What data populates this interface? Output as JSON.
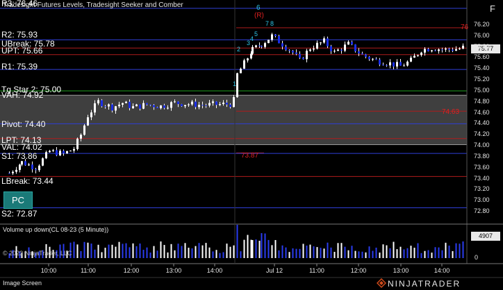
{
  "window": {
    "title": "Tradesight Futures Levels, Tradesight Seeker and Comber",
    "status_bar": "Image Screen",
    "brand": "NINJATRADER",
    "copyright": "© 2023 NinjaTrader, LLC",
    "f_button": "F",
    "pc_button": "PC"
  },
  "colors": {
    "background": "#000000",
    "up_candle": "#ffffff",
    "down_candle": "#1a2ee6",
    "level_blue": "#2f3fd8",
    "level_red": "#b01c1c",
    "value_area_fill": "#4a4a4a",
    "green_line": "#1fa21f",
    "teal_button": "#1a7a78"
  },
  "price_levels": [
    {
      "name": "R2",
      "label": "R2: 75.93",
      "price": 75.93,
      "color": "#2f3fd8"
    },
    {
      "name": "UBreak",
      "label": "UBreak: 75.78",
      "price": 75.78,
      "color": "#b01c1c"
    },
    {
      "name": "UPT",
      "label": "UPT: 75.66",
      "price": 75.66,
      "color": "#b01c1c"
    },
    {
      "name": "R1",
      "label": "R1: 75.39",
      "price": 75.39,
      "color": "#2f3fd8"
    },
    {
      "name": "TgStar",
      "label": "Tg Star 2: 75.00",
      "price": 75.0,
      "color": "#1fa21f"
    },
    {
      "name": "VAH",
      "label": "VAH: 74.92",
      "price": 74.92,
      "color": "#9a9a9a"
    },
    {
      "name": "Pivot",
      "label": "Pivot: 74.40",
      "price": 74.4,
      "color": "#2f3fd8"
    },
    {
      "name": "LPT",
      "label": "LPT: 74.13",
      "price": 74.13,
      "color": "#b01c1c"
    },
    {
      "name": "VAL",
      "label": "VAL: 74.02",
      "price": 74.02,
      "color": "#9a9a9a"
    },
    {
      "name": "S1",
      "label": "S1: 73.86",
      "price": 73.86,
      "color": "#2f3fd8"
    },
    {
      "name": "LBreak",
      "label": "LBreak: 73.44",
      "price": 73.44,
      "color": "#b01c1c"
    },
    {
      "name": "S2",
      "label": "S2: 72.87",
      "price": 72.87,
      "color": "#2f3fd8"
    }
  ],
  "r3_label": "R3: 76.46",
  "annotations": {
    "red_76": "76",
    "red_7463": "74.63",
    "red_7387": "73.87",
    "seq_6": "6",
    "seq_R": "(R)",
    "seq_1": "1",
    "seq_2": "2",
    "seq_3": "3",
    "seq_4": "4",
    "seq_5": "5",
    "seq_7": "7",
    "seq_8": "8"
  },
  "price_axis": {
    "ticks": [
      "76.20",
      "76.00",
      "75.80",
      "75.60",
      "75.40",
      "75.20",
      "75.00",
      "74.80",
      "74.60",
      "74.40",
      "74.20",
      "74.00",
      "73.80",
      "73.60",
      "73.40",
      "73.20",
      "73.00",
      "72.80"
    ],
    "current_price": "75.77"
  },
  "volume_panel": {
    "title": "Volume up down(CL 08-23 (5 Minute))",
    "current_volume": "4907",
    "zero_label": "0"
  },
  "time_axis": {
    "ticks": [
      "10:00",
      "11:00",
      "12:00",
      "13:00",
      "14:00",
      "Jul 12",
      "11:00",
      "12:00",
      "13:00",
      "14:00"
    ]
  }
}
